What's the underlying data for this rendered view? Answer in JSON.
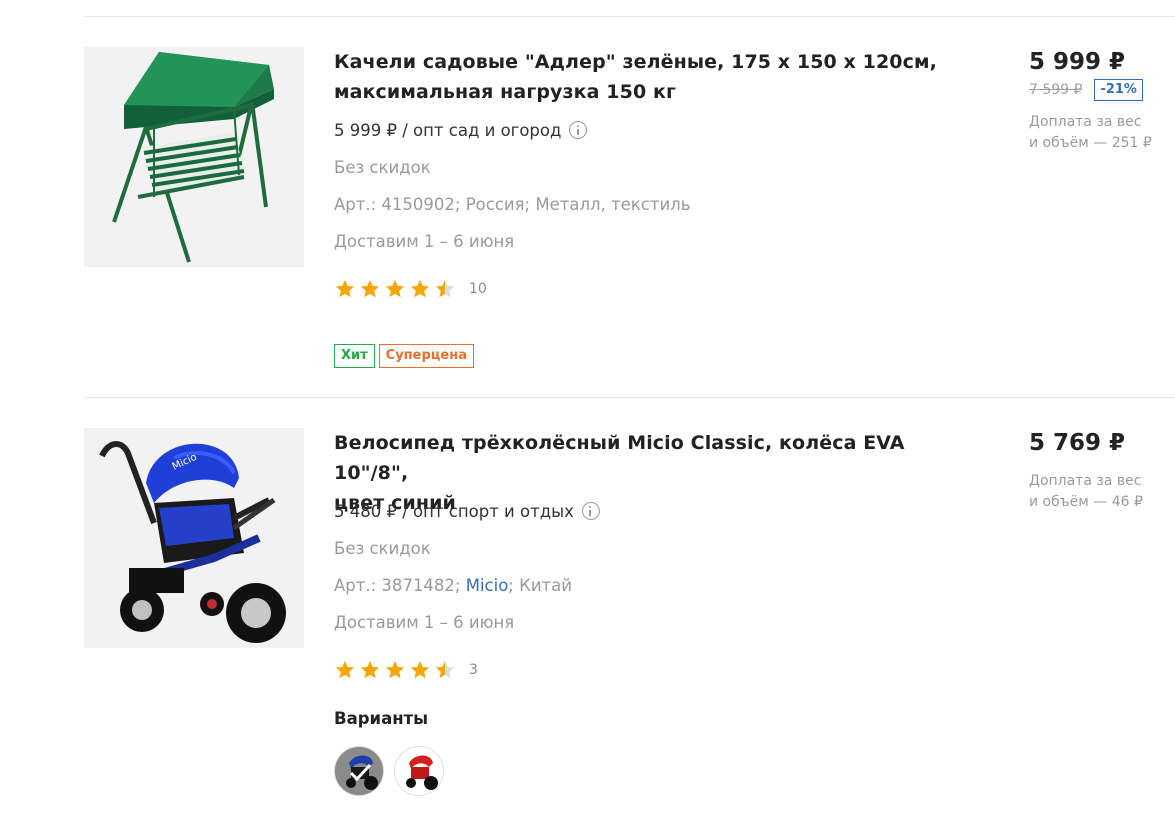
{
  "products": [
    {
      "title_line1": "Качели садовые \"Адлер\" зелёные, 175 x 150 x 120см,",
      "title_line2": "максимальная нагрузка 150 кг",
      "wholesale": "5 999 ₽ / опт сад и огород",
      "discount_note": "Без скидок",
      "article_prefix": "Арт.: 4150902; Россия; Металл, текстиль",
      "delivery": "Доставим 1 – 6 июня",
      "rating": 4.5,
      "rating_count": "10",
      "badges": [
        "Хит",
        "Суперцена"
      ],
      "price": "5 999 ₽",
      "old_price": "7 599 ₽",
      "discount": "-21%",
      "surcharge_line1": "Доплата за вес",
      "surcharge_line2": "и объём — 251 ₽",
      "image_icon": "garden-swing-icon"
    },
    {
      "title_line1": "Велосипед трёхколёсный Micio Classic, колёса EVA 10\"/8\",",
      "title_line2": "цвет синий",
      "wholesale": "5 480 ₽ / опт спорт и отдых",
      "discount_note": "Без скидок",
      "article_prefix": "Арт.: 3871482; ",
      "article_brand": "Micio",
      "article_suffix": "; Китай",
      "delivery": "Доставим 1 – 6 июня",
      "rating": 4.5,
      "rating_count": "3",
      "variants_label": "Варианты",
      "variants": [
        {
          "color": "#1f3fa8",
          "selected": true
        },
        {
          "color": "#d42020",
          "selected": false
        }
      ],
      "price": "5 769 ₽",
      "surcharge_line1": "Доплата за вес",
      "surcharge_line2": "и объём — 46 ₽",
      "image_icon": "tricycle-icon"
    }
  ],
  "colors": {
    "star": "#f5a70a",
    "star_empty": "#dcdcdc",
    "hit_badge": "#28a745",
    "super_badge": "#e8702a",
    "discount": "#2f6fb7",
    "link": "#2f6fb7"
  }
}
